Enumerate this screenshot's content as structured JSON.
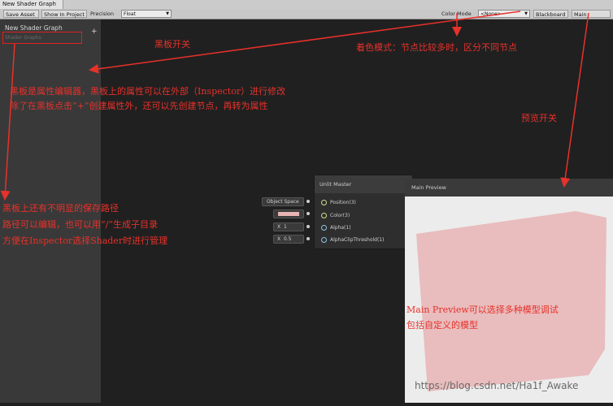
{
  "window": {
    "tab_title": "New Shader Graph"
  },
  "toolbar": {
    "save_label": "Save Asset",
    "show_label": "Show In Project",
    "precision_label": "Precision",
    "precision_value": "Float",
    "color_mode_label": "Color Mode",
    "color_mode_value": "<None>",
    "blackboard_label": "Blackboard",
    "main_preview_label": "Main Preview"
  },
  "blackboard": {
    "title": "New Shader Graph",
    "path": "Shader Graphs",
    "add_label": "+"
  },
  "master_node": {
    "title": "Unlit Master",
    "ports": [
      {
        "label": "Position(3)",
        "input": "Object Space"
      },
      {
        "label": "Color(3)",
        "input": ""
      },
      {
        "label": "Alpha(1)",
        "input_axis": "X",
        "input": "1"
      },
      {
        "label": "AlphaClipThreshold(1)",
        "input_axis": "X",
        "input": "0.5"
      }
    ],
    "color_swatch": "#e8b4b4"
  },
  "main_preview": {
    "title": "Main Preview",
    "cube_color": "#e9bcbd"
  },
  "annotations": {
    "blackboard_toggle": "黑板开关",
    "color_mode": "着色模式：节点比较多时，区分不同节点",
    "preview_toggle": "预览开关",
    "blackboard_desc_1": "黑板是属性编辑器，黑板上的属性可以在外部（Inspector）进行修改",
    "blackboard_desc_2": "除了在黑板点击“+”创建属性外，还可以先创建节点，再转为属性",
    "path_desc_1": "黑板上还有不明显的保存路径",
    "path_desc_2": "路径可以编辑，也可以用“/”生成子目录",
    "path_desc_3": "方便在Inspector选择Shader时进行管理",
    "preview_desc_1": "Main Preview可以选择多种模型调试",
    "preview_desc_2": "包括自定义的模型"
  },
  "watermark": "https://blog.csdn.net/Ha1f_Awake",
  "colors": {
    "annotation": "#e8312a",
    "cube": "#e9bcbd"
  }
}
